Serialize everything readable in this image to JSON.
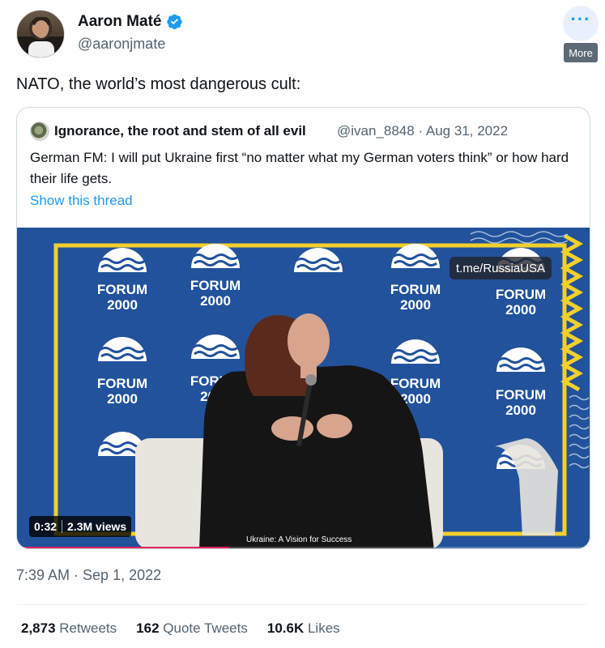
{
  "author": {
    "name": "Aaron Maté",
    "handle": "@aaronjmate",
    "verified": true,
    "avatar_icon": "profile-photo"
  },
  "more": {
    "icon": "more-dots-icon",
    "tooltip": "More"
  },
  "tweet": {
    "text": "NATO, the world’s most dangerous cult:",
    "timestamp": "7:39 AM · Sep 1, 2022"
  },
  "quote": {
    "author_name": "Ignorance, the root and stem of all evil",
    "handle_date": "@ivan_8848 · Aug 31, 2022",
    "text": "German FM: I will put Ukraine first “no matter what my German voters think” or how hard their life gets.",
    "show_thread": "Show this thread"
  },
  "video": {
    "watermark": "t.me/RussiaUSA",
    "time": "0:32",
    "views": "2.3M views",
    "progress": 0.37,
    "caption": "Ukraine: A Vision for Success",
    "backdrop_text": [
      "FORUM",
      "2000"
    ]
  },
  "stats": {
    "retweets_count": "2,873",
    "retweets_label": "Retweets",
    "quotes_count": "162",
    "quotes_label": "Quote Tweets",
    "likes_count": "10.6K",
    "likes_label": "Likes"
  },
  "colors": {
    "accent": "#1d9bf0",
    "secondary_text": "#536471",
    "video_bg": "#22529c",
    "frame_yellow": "#f2d02b"
  }
}
